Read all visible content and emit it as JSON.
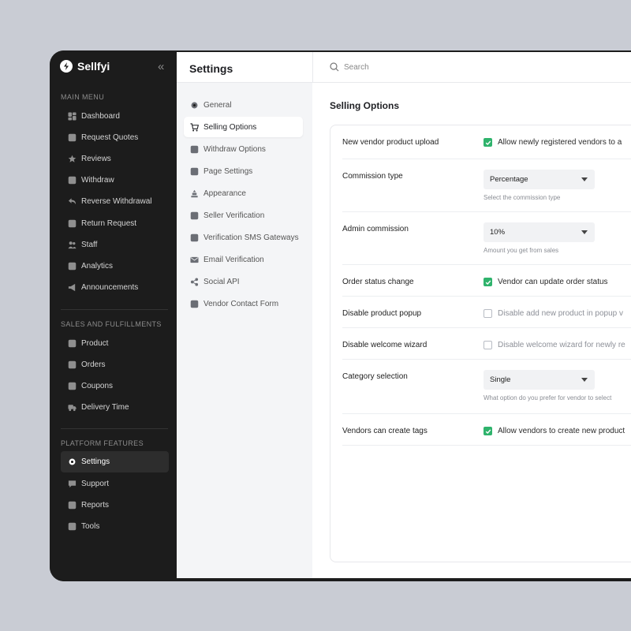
{
  "app": {
    "name": "Sellfyi"
  },
  "sidebar": {
    "sections": [
      {
        "title": "MAIN MENU",
        "items": [
          {
            "label": "Dashboard",
            "icon": "dashboard-icon"
          },
          {
            "label": "Request Quotes",
            "icon": "quote-icon"
          },
          {
            "label": "Reviews",
            "icon": "star-icon"
          },
          {
            "label": "Withdraw",
            "icon": "withdraw-icon"
          },
          {
            "label": "Reverse Withdrawal",
            "icon": "reverse-icon"
          },
          {
            "label": "Return Request",
            "icon": "return-icon"
          },
          {
            "label": "Staff",
            "icon": "staff-icon"
          },
          {
            "label": "Analytics",
            "icon": "analytics-icon"
          },
          {
            "label": "Announcements",
            "icon": "megaphone-icon"
          }
        ]
      },
      {
        "title": "SALES AND FULFILLMENTS",
        "items": [
          {
            "label": "Product",
            "icon": "box-icon"
          },
          {
            "label": "Orders",
            "icon": "orders-icon"
          },
          {
            "label": "Coupons",
            "icon": "coupon-icon"
          },
          {
            "label": "Delivery Time",
            "icon": "truck-icon"
          }
        ]
      },
      {
        "title": "PLATFORM FEATURES",
        "items": [
          {
            "label": "Settings",
            "icon": "gear-icon",
            "active": true
          },
          {
            "label": "Support",
            "icon": "chat-icon"
          },
          {
            "label": "Reports",
            "icon": "report-icon"
          },
          {
            "label": "Tools",
            "icon": "tools-icon"
          }
        ]
      }
    ]
  },
  "header": {
    "title": "Settings",
    "search_placeholder": "Search"
  },
  "subnav": [
    {
      "label": "General",
      "icon": "gear-icon"
    },
    {
      "label": "Selling Options",
      "icon": "cart-icon",
      "active": true
    },
    {
      "label": "Withdraw Options",
      "icon": "withdraw-icon"
    },
    {
      "label": "Page Settings",
      "icon": "page-icon"
    },
    {
      "label": "Appearance",
      "icon": "appearance-icon"
    },
    {
      "label": "Seller Verification",
      "icon": "verify-icon"
    },
    {
      "label": "Verification SMS Gateways",
      "icon": "sms-icon"
    },
    {
      "label": "Email Verification",
      "icon": "email-icon"
    },
    {
      "label": "Social API",
      "icon": "social-icon"
    },
    {
      "label": "Vendor Contact Form",
      "icon": "contact-icon"
    }
  ],
  "main": {
    "heading": "Selling Options",
    "rows": [
      {
        "label": "New vendor product upload",
        "kind": "checkbox",
        "checked": true,
        "text": "Allow newly registered vendors to a"
      },
      {
        "label": "Commission type",
        "kind": "select",
        "value": "Percentage",
        "helper": "Select the commission type"
      },
      {
        "label": "Admin commission",
        "kind": "select",
        "value": "10%",
        "helper": "Amount you get from sales"
      },
      {
        "label": "Order status change",
        "kind": "checkbox",
        "checked": true,
        "text": "Vendor can update order status"
      },
      {
        "label": "Disable product popup",
        "kind": "checkbox",
        "checked": false,
        "text": "Disable add new product in popup v"
      },
      {
        "label": "Disable welcome wizard",
        "kind": "checkbox",
        "checked": false,
        "text": "Disable welcome wizard for newly re"
      },
      {
        "label": "Category selection",
        "kind": "select",
        "value": "Single",
        "helper": "What option do you prefer for vendor to select"
      },
      {
        "label": "Vendors can create tags",
        "kind": "checkbox",
        "checked": true,
        "text": "Allow vendors to create new product"
      }
    ]
  },
  "colors": {
    "accent": "#2fb36c",
    "sidebar_bg": "#1c1c1c",
    "subnav_bg": "#f4f5f7"
  }
}
